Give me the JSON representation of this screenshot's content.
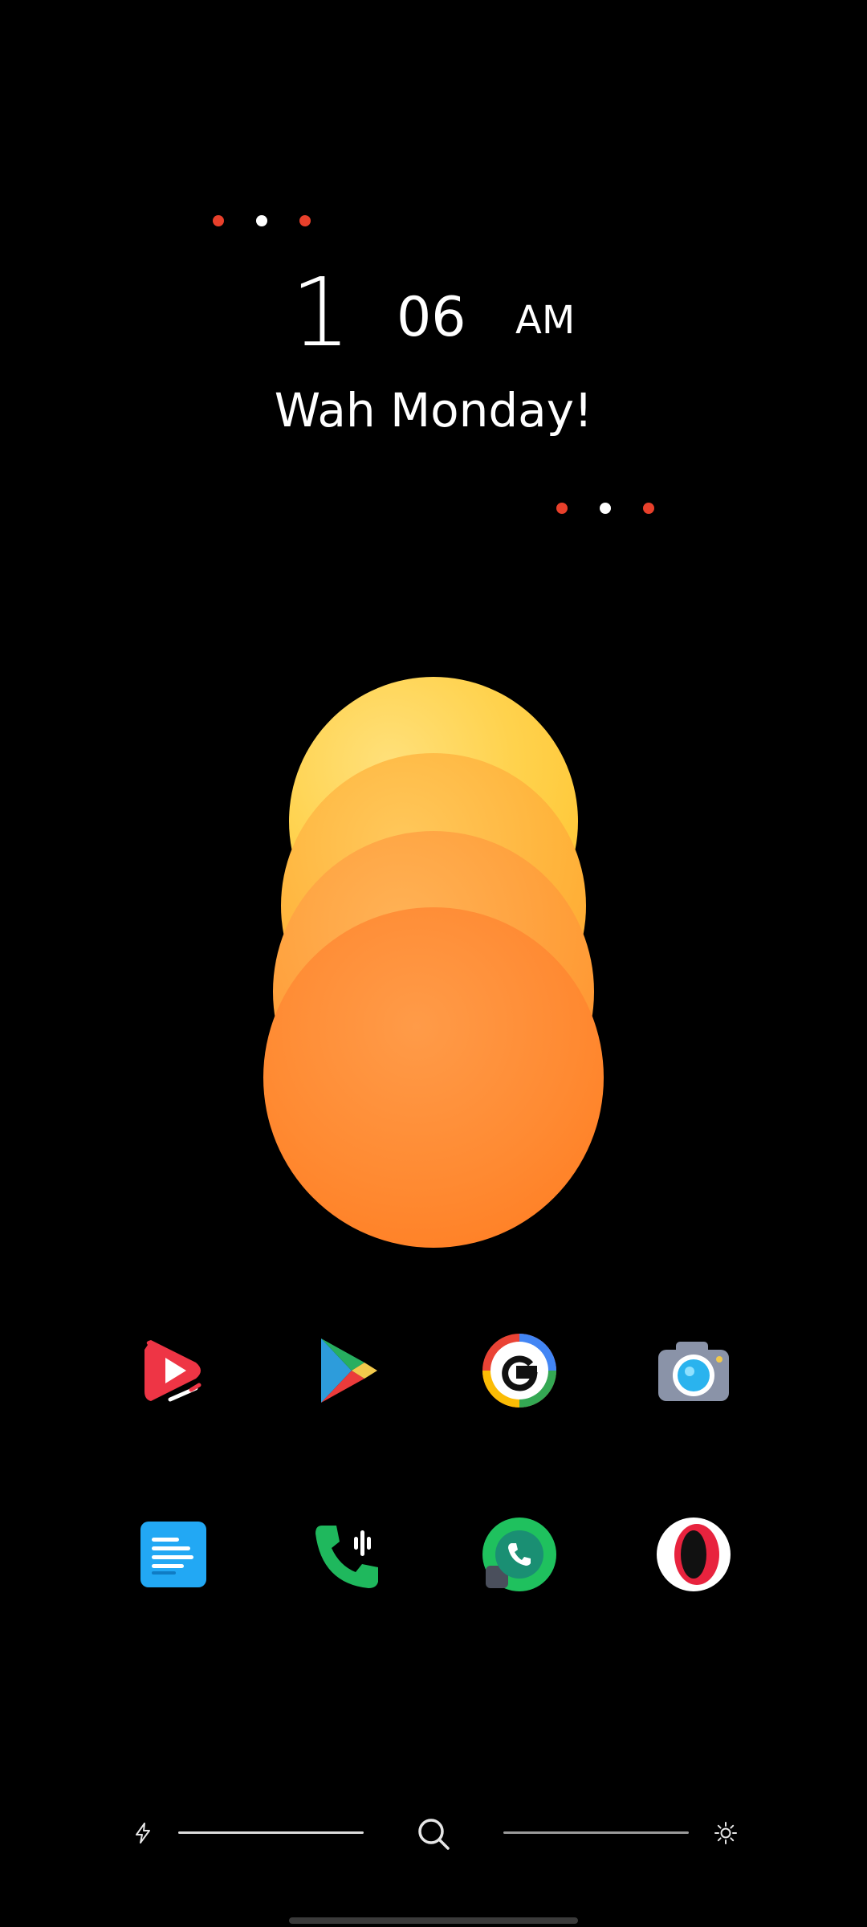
{
  "clock": {
    "hour": "1",
    "minute": "06",
    "ampm": "AM",
    "greeting": "Wah Monday!"
  },
  "colors": {
    "accent_red": "#e8402b",
    "dot_white": "#ffffff",
    "background": "#000000"
  },
  "apps": {
    "row1": [
      {
        "name": "video-player-icon"
      },
      {
        "name": "play-store-icon"
      },
      {
        "name": "google-icon"
      },
      {
        "name": "camera-icon"
      }
    ],
    "row2": [
      {
        "name": "notes-icon"
      },
      {
        "name": "phone-icon"
      },
      {
        "name": "whatsapp-icon"
      },
      {
        "name": "opera-icon"
      }
    ]
  },
  "bottom_bar": {
    "left_icon": "flash-icon",
    "center_icon": "search-icon",
    "right_icon": "brightness-icon"
  }
}
